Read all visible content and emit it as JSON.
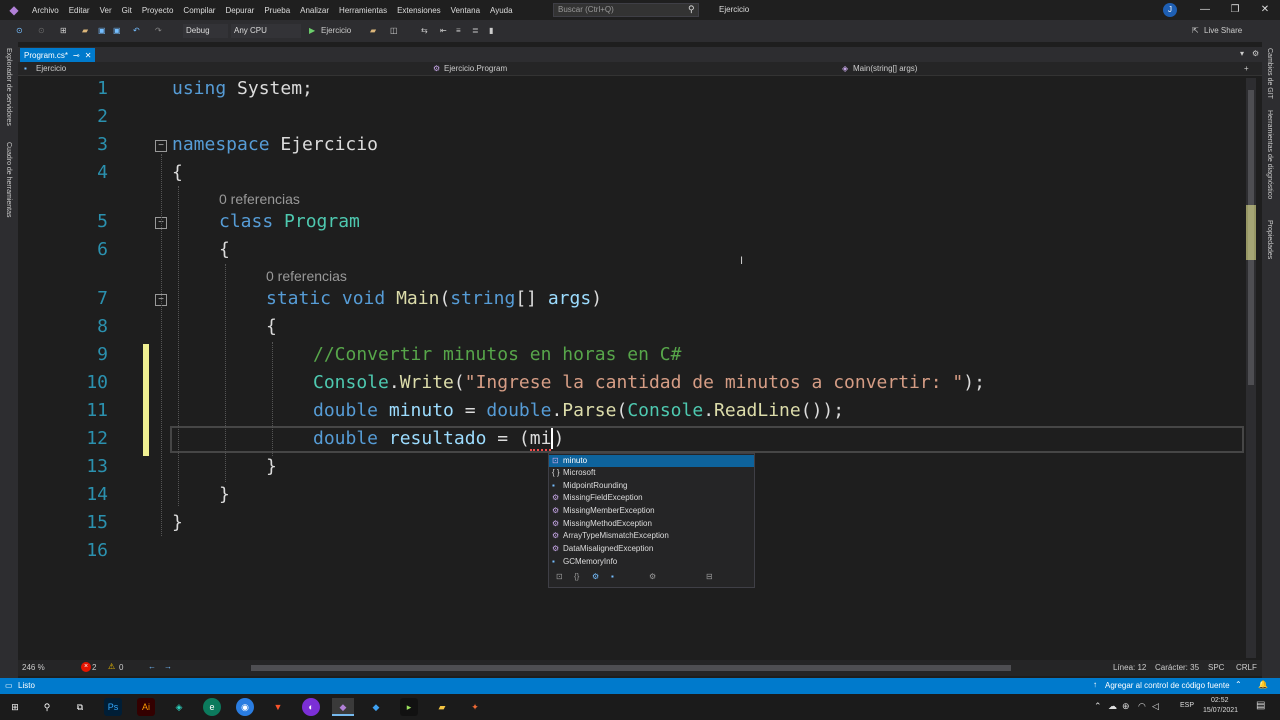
{
  "titlebar": {
    "menu": [
      "Archivo",
      "Editar",
      "Ver",
      "Git",
      "Proyecto",
      "Compilar",
      "Depurar",
      "Prueba",
      "Analizar",
      "Herramientas",
      "Extensiones",
      "Ventana",
      "Ayuda"
    ],
    "search_placeholder": "Buscar (Ctrl+Q)",
    "solution": "Ejercicio",
    "user_initial": "J"
  },
  "toolbar": {
    "config": "Debug",
    "platform": "Any CPU",
    "run": "Ejercicio",
    "live_share": "Live Share"
  },
  "left_rail": [
    "Explorador de servidores",
    "Cuadro de herramientas"
  ],
  "right_rail": [
    "Cambios de GIT",
    "Herramientas de diagnóstico",
    "Propiedades"
  ],
  "tab": {
    "label": "Program.cs*"
  },
  "navbar": {
    "project": "Ejercicio",
    "class": "Ejercicio.Program",
    "member": "Main(string[] args)"
  },
  "code": {
    "line_numbers": [
      "1",
      "2",
      "3",
      "4",
      "5",
      "6",
      "7",
      "8",
      "9",
      "10",
      "11",
      "12",
      "13",
      "14",
      "15",
      "16"
    ],
    "refs": "0 referencias",
    "l1a": "using",
    "l1b": " System;",
    "l3a": "namespace",
    "l3b": " Ejercicio",
    "brace_open": "{",
    "brace_close": "}",
    "l5a": "class",
    "l5b": "Program",
    "l7a": "static",
    "l7b": "void",
    "l7c": "Main",
    "l7d": "(",
    "l7e": "string",
    "l7f": "[] ",
    "l7g": "args",
    "l7h": ")",
    "l9": "//Convertir minutos en horas en C#",
    "l10a": "Console",
    "l10b": ".",
    "l10c": "Write",
    "l10d": "(",
    "l10e": "\"Ingrese la cantidad de minutos a convertir: \"",
    "l10f": ");",
    "l11a": "double",
    "l11b": "minuto",
    "l11c": " = ",
    "l11d": "double",
    "l11e": ".",
    "l11f": "Parse",
    "l11g": "(",
    "l11h": "Console",
    "l11i": ".",
    "l11j": "ReadLine",
    "l11k": "());",
    "l12a": "double",
    "l12b": "resultado",
    "l12c": " = (",
    "l12d": "mi",
    "l12e": ")"
  },
  "intellisense": {
    "items": [
      "minuto",
      "Microsoft",
      "MidpointRounding",
      "MissingFieldException",
      "MissingMemberException",
      "MissingMethodException",
      "ArrayTypeMismatchException",
      "DataMisalignedException",
      "GCMemoryInfo"
    ],
    "icons": [
      "⊡",
      "{ }",
      "▪",
      "⚙",
      "⚙",
      "⚙",
      "⚙",
      "⚙",
      "▪"
    ]
  },
  "bottom": {
    "zoom": "246 %",
    "errors": "2",
    "warnings": "0",
    "line": "Línea: 12",
    "char": "Carácter: 35",
    "spc": "SPC",
    "crlf": "CRLF"
  },
  "status": {
    "ready": "Listo",
    "source_control": "Agregar al control de código fuente"
  },
  "tray": {
    "lang": "ESP",
    "time": "02:52",
    "date": "15/07/2021"
  },
  "colors": {
    "accent": "#007acc",
    "keyword": "#569cd6",
    "type": "#4ec9b0",
    "string": "#d69d85",
    "comment": "#57a64a",
    "variable": "#9cdcfe",
    "method": "#dcdcaa"
  }
}
